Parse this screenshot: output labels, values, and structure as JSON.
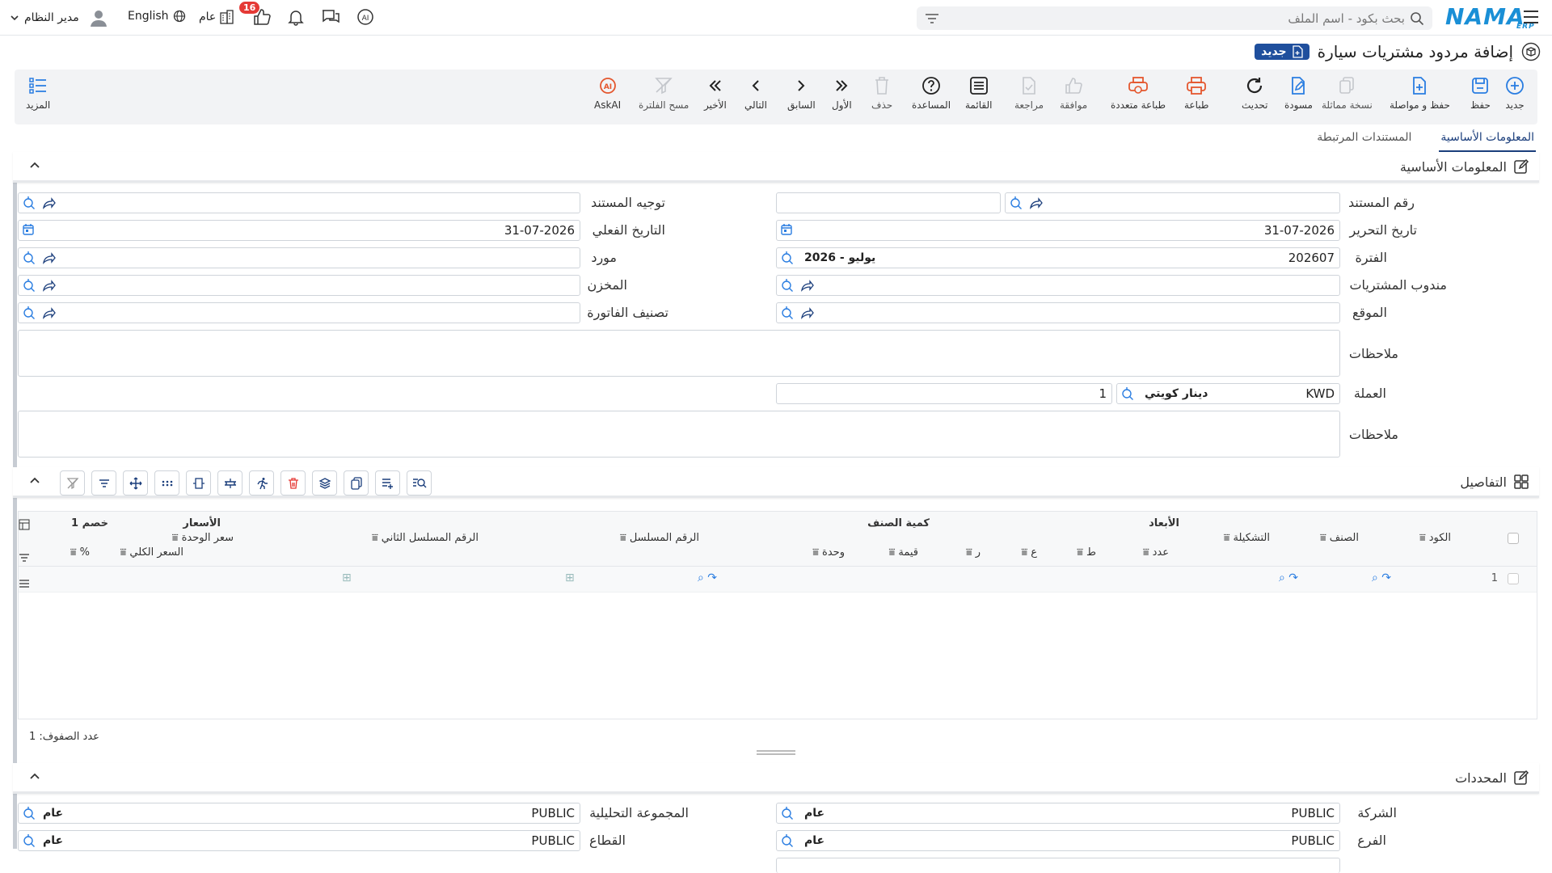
{
  "topbar": {
    "user_name": "مدير النظام",
    "language": "English",
    "company_label": "عام",
    "notification_count": "16",
    "search_placeholder": "بحث بكود - اسم الملف",
    "logo_text": "NAMA",
    "logo_sub": "ERP"
  },
  "page": {
    "title": "إضافة مردود مشتريات سيارة",
    "badge": "جديد"
  },
  "toolbar": {
    "new": "جديد",
    "save": "حفظ",
    "save_continue": "حفظ و مواصلة",
    "copy_similar": "نسخة مماثلة",
    "draft": "مسودة",
    "refresh": "تحديث",
    "print": "طباعة",
    "multi_print": "طباعة متعددة",
    "approve": "موافقة",
    "review": "مراجعة",
    "list": "القائمة",
    "help": "المساعدة",
    "delete": "حذف",
    "first": "الأول",
    "previous": "السابق",
    "next": "التالي",
    "last": "الأخير",
    "clear_filter": "مسح الفلترة",
    "askai": "AskAI",
    "more": "المزيد"
  },
  "tabs": {
    "basic": "المعلومات الأساسية",
    "related": "المستندات المرتبطة"
  },
  "basic_section": {
    "title": "المعلومات الأساسية",
    "doc_number_label": "رقم المستند",
    "doc_direction_label": "توجيه المستند",
    "edit_date_label": "تاريخ التحرير",
    "edit_date_value": "31-07-2026",
    "actual_date_label": "التاريخ الفعلي",
    "actual_date_value": "31-07-2026",
    "period_label": "الفترة",
    "period_value": "202607",
    "period_tag": "2026 - يوليو",
    "supplier_label": "مورد",
    "purchase_rep_label": "مندوب المشتريات",
    "warehouse_label": "المخزن",
    "location_label": "الموقع",
    "invoice_class_label": "تصنيف الفاتورة",
    "notes_label": "ملاحظات",
    "currency_label": "العملة",
    "currency_code": "KWD",
    "currency_name": "دينار كويتي",
    "currency_rate": "1",
    "notes2_label": "ملاحظات"
  },
  "details": {
    "title": "التفاصيل",
    "group_dimensions": "الأبعاد",
    "group_quantity": "كمية الصنف",
    "group_prices": "الأسعار",
    "group_discount": "خصم 1",
    "col_code": "الكود",
    "col_item": "الصنف",
    "col_config": "التشكيلة",
    "col_count": "عدد",
    "col_length": "ط",
    "col_width": "ع",
    "col_r": "ر",
    "col_value": "قيمة",
    "col_unit": "وحدة",
    "col_serial": "الرقم المسلسل",
    "col_serial2": "الرقم المسلسل الثاني",
    "col_unit_price": "سعر الوحدة",
    "col_total_price": "السعر الكلي",
    "col_percent": "%",
    "row_number": "1",
    "row_count_text": "عدد الصفوف: 1"
  },
  "dimensions_section": {
    "title": "المحددات",
    "company_label": "الشركة",
    "company_value": "PUBLIC",
    "company_tag": "عام",
    "analytic_group_label": "المجموعة التحليلية",
    "analytic_group_value": "PUBLIC",
    "analytic_group_tag": "عام",
    "branch_label": "الفرع",
    "branch_value": "PUBLIC",
    "branch_tag": "عام",
    "sector_label": "القطاع",
    "sector_value": "PUBLIC",
    "sector_tag": "عام"
  },
  "colors": {
    "brand": "#1a8fd6",
    "badge": "#1f4f9d",
    "accent_icon": "#2a7de1",
    "print_icon": "#e4572e",
    "notification": "#e53935"
  }
}
